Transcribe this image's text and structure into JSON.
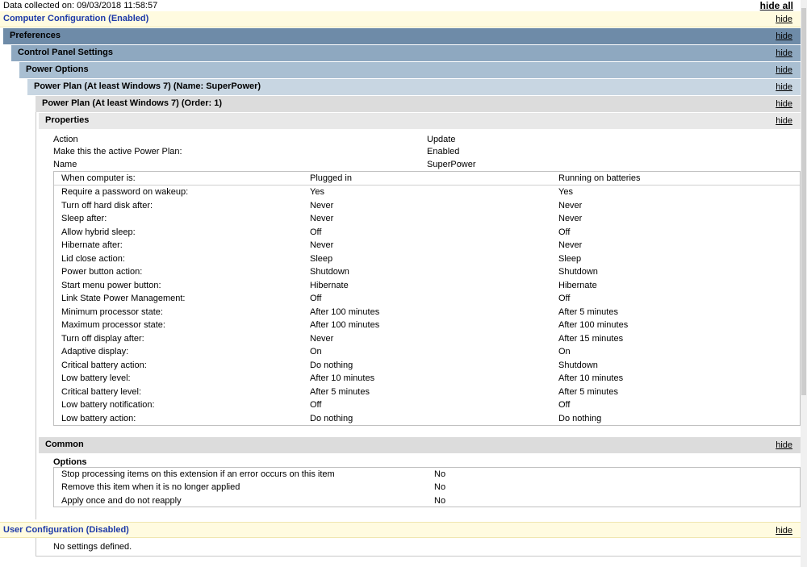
{
  "header": {
    "collected": "Data collected on: 09/03/2018 11:58:57",
    "hide_all": "hide all"
  },
  "hide_label": "hide",
  "computer_config": "Computer Configuration (Enabled)",
  "sections": {
    "preferences": "Preferences",
    "control_panel": "Control Panel Settings",
    "power_options": "Power Options",
    "power_plan_name": "Power Plan (At least Windows 7) (Name: SuperPower)",
    "power_plan_order": "Power Plan (At least Windows 7) (Order: 1)",
    "properties": "Properties",
    "common": "Common",
    "options": "Options"
  },
  "properties": [
    {
      "label": "Action",
      "value": "Update"
    },
    {
      "label": "Make this the active Power Plan:",
      "value": "Enabled"
    },
    {
      "label": "Name",
      "value": "SuperPower"
    }
  ],
  "power_table": {
    "headers": [
      "When computer is:",
      "Plugged in",
      "Running on batteries"
    ],
    "rows": [
      [
        "Require a password on wakeup:",
        "Yes",
        "Yes"
      ],
      [
        "Turn off hard disk after:",
        "Never",
        "Never"
      ],
      [
        "Sleep after:",
        "Never",
        "Never"
      ],
      [
        "Allow hybrid sleep:",
        "Off",
        "Off"
      ],
      [
        "Hibernate after:",
        "Never",
        "Never"
      ],
      [
        "Lid close action:",
        "Sleep",
        "Sleep"
      ],
      [
        "Power button action:",
        "Shutdown",
        "Shutdown"
      ],
      [
        "Start menu power button:",
        "Hibernate",
        "Hibernate"
      ],
      [
        "Link State Power Management:",
        "Off",
        "Off"
      ],
      [
        "Minimum processor state:",
        "After 100 minutes",
        "After 5 minutes"
      ],
      [
        "Maximum processor state:",
        "After 100 minutes",
        "After 100 minutes"
      ],
      [
        "Turn off display after:",
        "Never",
        "After 15 minutes"
      ],
      [
        "Adaptive display:",
        "On",
        "On"
      ],
      [
        "Critical battery action:",
        "Do nothing",
        "Shutdown"
      ],
      [
        "Low battery level:",
        "After 10 minutes",
        "After 10 minutes"
      ],
      [
        "Critical battery level:",
        "After 5 minutes",
        "After 5 minutes"
      ],
      [
        "Low battery notification:",
        "Off",
        "Off"
      ],
      [
        "Low battery action:",
        "Do nothing",
        "Do nothing"
      ]
    ]
  },
  "options": [
    {
      "label": "Stop processing items on this extension if an error occurs on this item",
      "value": "No"
    },
    {
      "label": "Remove this item when it is no longer applied",
      "value": "No"
    },
    {
      "label": "Apply once and do not reapply",
      "value": "No"
    }
  ],
  "user_config": "User Configuration (Disabled)",
  "no_settings": "No settings defined."
}
